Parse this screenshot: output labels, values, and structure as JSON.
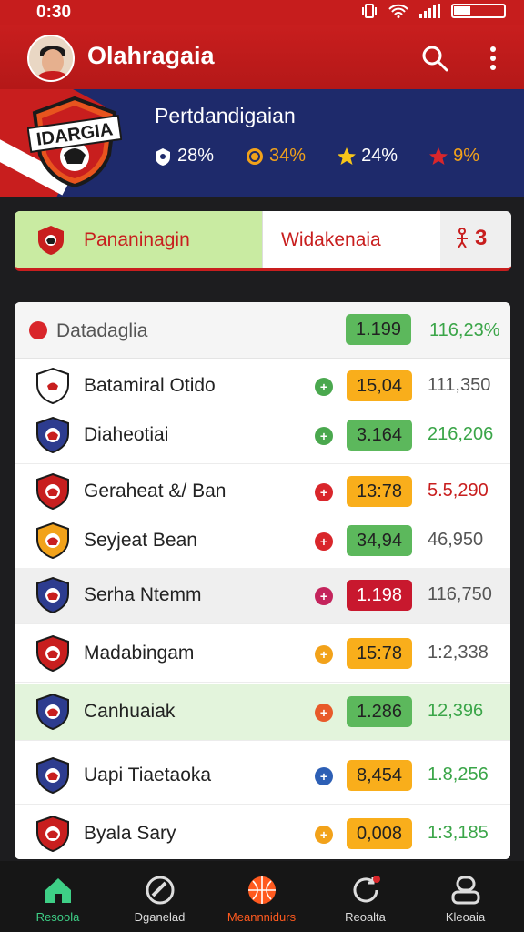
{
  "status_bar": {
    "time": "0:30"
  },
  "app_bar": {
    "title": "Olahragaia"
  },
  "banner": {
    "logo_text": "IDARGIA",
    "title": "Pertdandigaian",
    "stats": [
      {
        "icon": "shield-icon",
        "value": "28%",
        "color": "#ffffff"
      },
      {
        "icon": "coin-icon",
        "value": "34%",
        "color": "#f2a21a"
      },
      {
        "icon": "star-icon",
        "value": "24%",
        "color": "#ffffff"
      },
      {
        "icon": "star-icon",
        "value": "9%",
        "color": "#f2a21a"
      }
    ]
  },
  "tabs": {
    "tab1": "Pananinagin",
    "tab2": "Widakenaia",
    "tab3": "3"
  },
  "list": {
    "header": {
      "label": "Datadaglia",
      "pill": "1.199",
      "value": "116,23%"
    },
    "rows": [
      {
        "name": "Batamiral Otido",
        "dot": "+",
        "dot_color": "#4aa84e",
        "pill": "15,04",
        "pill_color": "#f9ae1b",
        "value": "111,350",
        "value_color": "#555555"
      },
      {
        "name": "Diaheotiai",
        "dot": "+",
        "dot_color": "#4aa84e",
        "pill": "3.164",
        "pill_color": "#5cb85c",
        "value": "216,206",
        "value_color": "#3aa548"
      },
      {
        "name": "Geraheat &/ Ban",
        "dot": "+",
        "dot_color": "#d9262b",
        "pill": "13:78",
        "pill_color": "#f9ae1b",
        "value": "5.5,290",
        "value_color": "#c81e1e"
      },
      {
        "name": "Seyjeat Bean",
        "dot": "+",
        "dot_color": "#d9262b",
        "pill": "34,94",
        "pill_color": "#5cb85c",
        "value": "46,950",
        "value_color": "#555555"
      },
      {
        "name": "Serha Ntemm",
        "dot": "+",
        "dot_color": "#c4245c",
        "pill": "1.198",
        "pill_color": "#c8182e",
        "value": "116,750",
        "value_color": "#555555"
      },
      {
        "name": "Madabingam",
        "dot": "+",
        "dot_color": "#f2a21a",
        "pill": "15:78",
        "pill_color": "#f9ae1b",
        "value": "1:2,338",
        "value_color": "#555555"
      },
      {
        "name": "Canhuaiak",
        "dot": "+",
        "dot_color": "#e85a2a",
        "pill": "1.286",
        "pill_color": "#5cb85c",
        "value": "12,396",
        "value_color": "#3aa548"
      },
      {
        "name": "Uapi Tiaetaoka",
        "dot": "+",
        "dot_color": "#2d5fb5",
        "pill": "8,454",
        "pill_color": "#f9ae1b",
        "value": "1.8,256",
        "value_color": "#3aa548"
      },
      {
        "name": "Byala Sary",
        "dot": "+",
        "dot_color": "#f2a21a",
        "pill": "0,008",
        "pill_color": "#f9ae1b",
        "value": "1:3,185",
        "value_color": "#3aa548"
      }
    ]
  },
  "bottom_nav": [
    {
      "label": "Resoola",
      "icon": "home-icon",
      "color": "#3ecf86"
    },
    {
      "label": "Dganelad",
      "icon": "ball-icon",
      "color": "#dddddd"
    },
    {
      "label": "Meannnidurs",
      "icon": "basketball-icon",
      "color": "#ff5a1f"
    },
    {
      "label": "Reoalta",
      "icon": "refresh-icon",
      "color": "#dddddd"
    },
    {
      "label": "Kleoaia",
      "icon": "profile-icon",
      "color": "#dddddd"
    }
  ]
}
